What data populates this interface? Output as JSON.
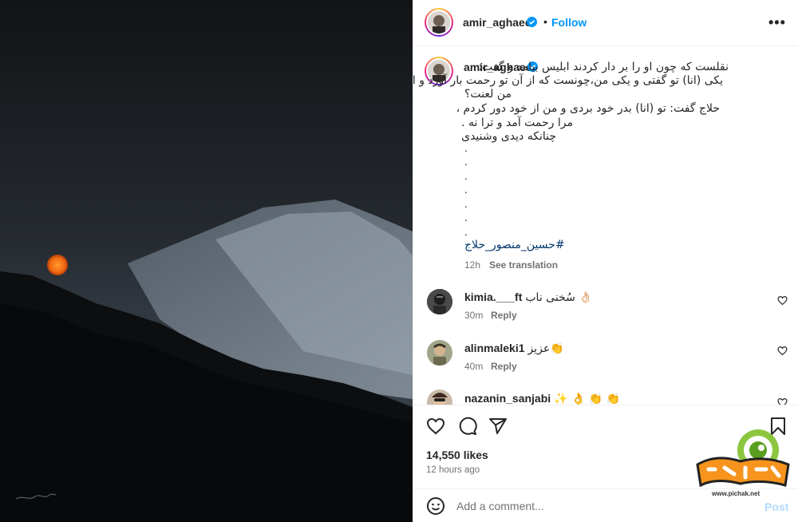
{
  "header": {
    "username": "amir_aghaee",
    "follow_label": "Follow",
    "separator": "•",
    "more_label": "•••"
  },
  "caption": {
    "username": "amir_aghaee",
    "lines": [
      "نقلست که چون او را بر دار کردند ابلیس بیامد و گفت:",
      "یکی (انا) تو گفتی و یکی من،چونست که از آن تو رحمت بار آورد و از آن",
      "من لعنت؟",
      "حلاج گفت: تو (انا) بدر خود بردی و من از خود دور کردم ،",
      "مرا رحمت آمد و ترا نه .",
      "چنانکه دیدی وشنیدی"
    ],
    "dots": [
      ".",
      ".",
      ".",
      ".",
      ".",
      ".",
      "."
    ],
    "hashtag": "#حسین_منصور_حلاج",
    "time": "12h",
    "see_translation": "See translation"
  },
  "comments": [
    {
      "username": "kimia.___ft",
      "text": "سُخنی ناب 👌🏻",
      "time": "30m",
      "reply": "Reply"
    },
    {
      "username": "alinmaleki1",
      "text": "عزیز👏",
      "time": "40m",
      "reply": "Reply"
    },
    {
      "username": "nazanin_sanjabi",
      "text": "✨ 👌 👏 👏",
      "time": "",
      "reply": ""
    }
  ],
  "stats": {
    "likes": "14,550 likes",
    "posted": "12 hours ago"
  },
  "comment_bar": {
    "placeholder": "Add a comment...",
    "post_label": "Post"
  },
  "watermark": {
    "text": "www.pichak.net"
  },
  "colors": {
    "accent": "#0095f6",
    "hashtag": "#00376b",
    "muted": "#737373",
    "post_disabled": "#b3dbff"
  },
  "icons": [
    "verified-icon",
    "more-icon",
    "heart-icon",
    "comment-icon",
    "share-icon",
    "bookmark-icon",
    "emoji-icon"
  ]
}
